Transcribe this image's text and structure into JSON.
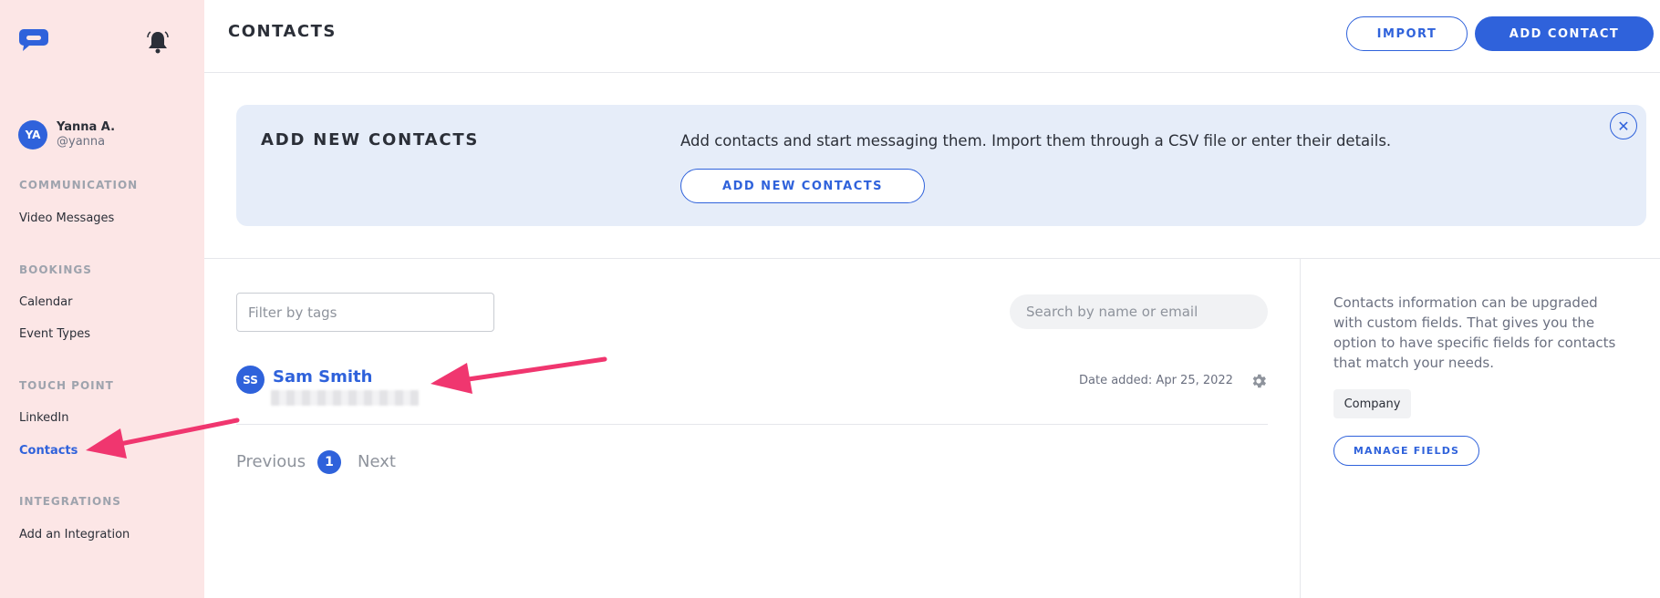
{
  "sidebar": {
    "user": {
      "initials": "YA",
      "name": "Yanna A.",
      "handle": "@yanna"
    },
    "sections": [
      {
        "title": "COMMUNICATION",
        "items": [
          "Video Messages"
        ]
      },
      {
        "title": "BOOKINGS",
        "items": [
          "Calendar",
          "Event Types"
        ]
      },
      {
        "title": "TOUCH POINT",
        "items": [
          "LinkedIn",
          "Contacts"
        ]
      },
      {
        "title": "INTEGRATIONS",
        "items": [
          "Add an Integration"
        ]
      }
    ],
    "active_item": "Contacts"
  },
  "header": {
    "title": "CONTACTS",
    "import_label": "IMPORT",
    "add_contact_label": "ADD CONTACT"
  },
  "banner": {
    "title": "ADD NEW CONTACTS",
    "description": "Add contacts and start messaging them. Import them through a CSV file or enter their details.",
    "button_label": "ADD NEW CONTACTS",
    "close_symbol": "✕"
  },
  "filters": {
    "tags_placeholder": "Filter by tags",
    "search_placeholder": "Search by name or email"
  },
  "contacts": [
    {
      "initials": "SS",
      "name": "Sam Smith",
      "date_added": "Date added: Apr 25, 2022"
    }
  ],
  "pagination": {
    "previous": "Previous",
    "current": "1",
    "next": "Next"
  },
  "custom_fields": {
    "info": "Contacts information can be upgraded with custom fields. That gives you the option to have specific fields for contacts that match your needs.",
    "chip": "Company",
    "manage_label": "MANAGE FIELDS"
  },
  "colors": {
    "accent": "#2f62db",
    "sidebar_bg": "#fce6e6",
    "banner_bg": "#e6edf9",
    "annotation": "#f0366f"
  },
  "icons": {
    "logo": "chat-bubble-logo",
    "notifications": "bell-icon",
    "settings": "gear-icon",
    "close": "close-icon"
  }
}
